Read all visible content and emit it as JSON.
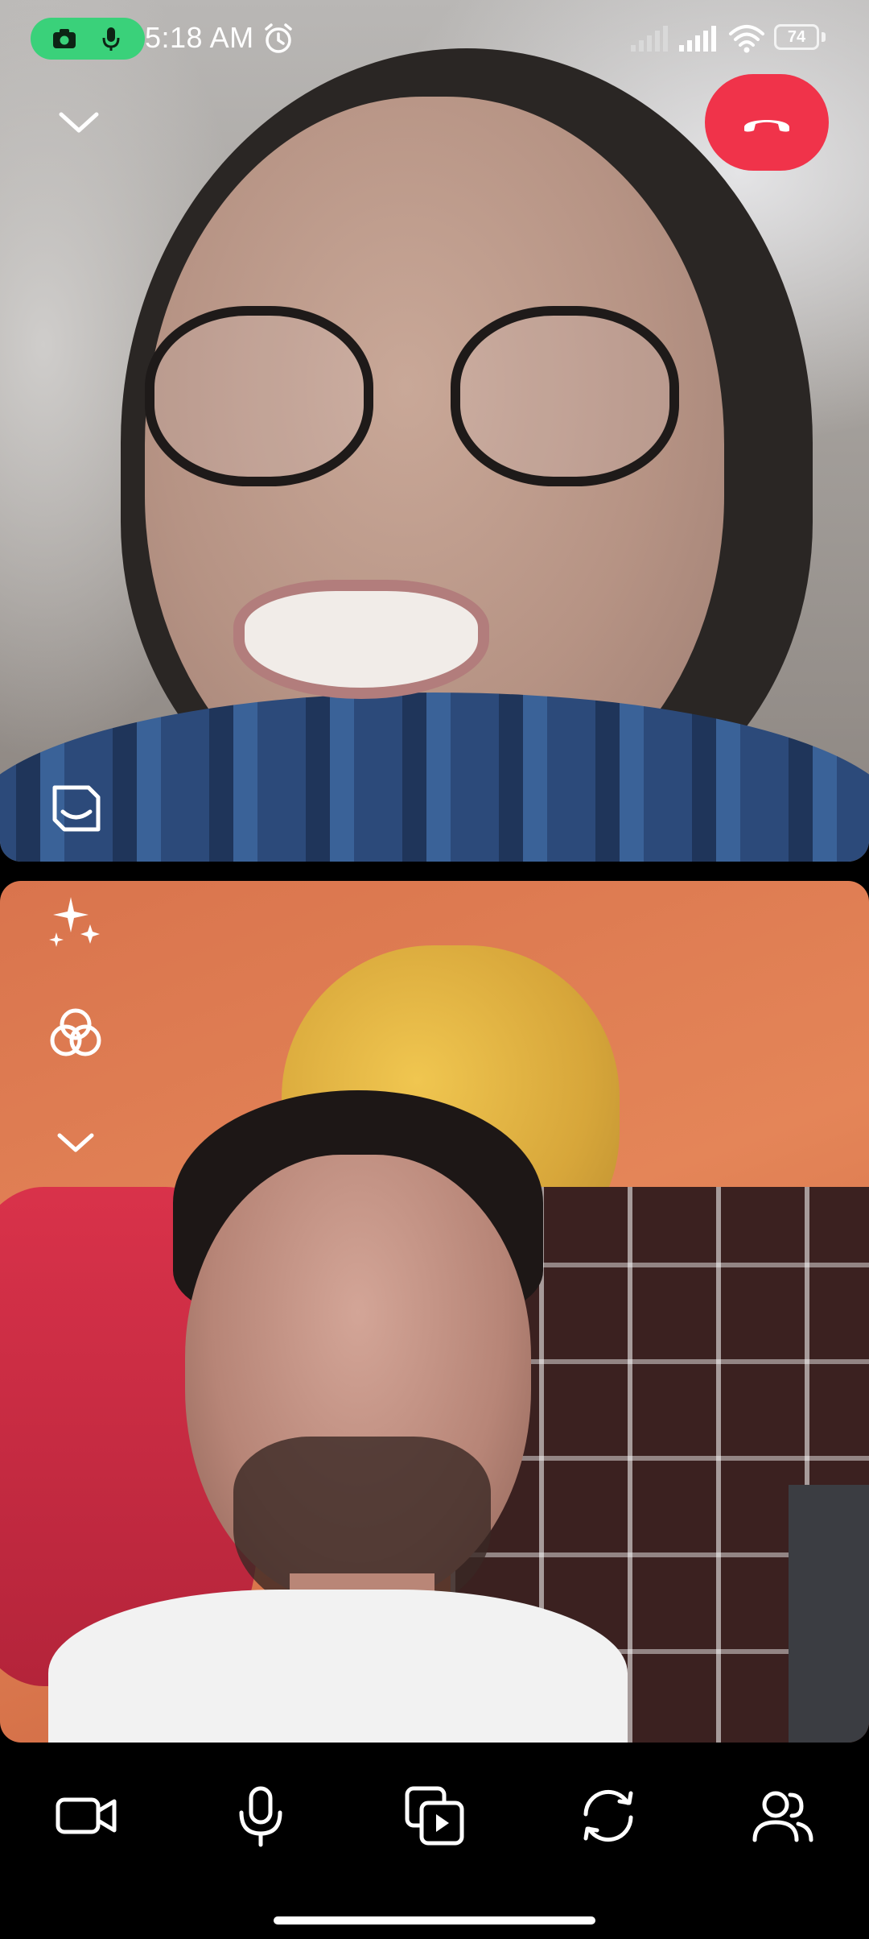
{
  "status_bar": {
    "time": "5:18 AM",
    "battery_level": "74",
    "privacy_indicator": [
      "camera-icon",
      "microphone-icon"
    ],
    "privacy_color": "#3ad17a"
  },
  "call": {
    "end_call_color": "#f0334a",
    "top_icons": [
      "chevron-down-icon",
      "end-call-icon",
      "sticker-icon"
    ],
    "side_icons": [
      "sparkles-effects-icon",
      "filters-icon",
      "chevron-down-icon"
    ]
  },
  "controls": [
    {
      "name": "camera-toggle-button",
      "icon": "video-camera-icon"
    },
    {
      "name": "microphone-toggle-button",
      "icon": "microphone-icon"
    },
    {
      "name": "share-media-button",
      "icon": "media-play-icon"
    },
    {
      "name": "flip-camera-button",
      "icon": "switch-camera-icon"
    },
    {
      "name": "participants-button",
      "icon": "people-icon"
    }
  ]
}
